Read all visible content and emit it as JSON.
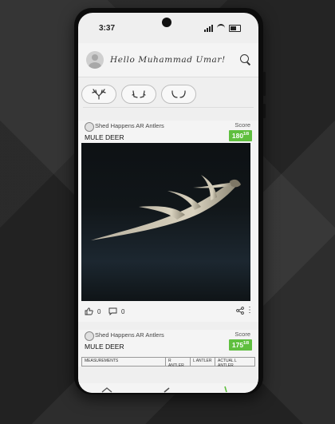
{
  "status": {
    "time": "3:37"
  },
  "header": {
    "greeting": "Hello Muhammad Umar!"
  },
  "filters": [
    {
      "icon": "deer-antler-icon"
    },
    {
      "icon": "elk-antler-icon"
    },
    {
      "icon": "moose-antler-icon"
    }
  ],
  "posts": [
    {
      "brand": "Shed Happens AR Antlers",
      "species": "MULE DEER",
      "score_label": "Score",
      "score": "180",
      "score_unit": "1/8",
      "likes": "0",
      "comments": "0"
    },
    {
      "brand": "Shed Happens AR Antlers",
      "species": "MULE DEER",
      "score_label": "Score",
      "score": "175",
      "score_unit": "1/8",
      "table_headers": [
        "MEASUREMENTS",
        "R ANTLER",
        "L ANTLER",
        "ACTUAL L ANTLER"
      ]
    }
  ],
  "colors": {
    "score_badge": "#5fbf3f",
    "accent": "#5fbf3f"
  }
}
